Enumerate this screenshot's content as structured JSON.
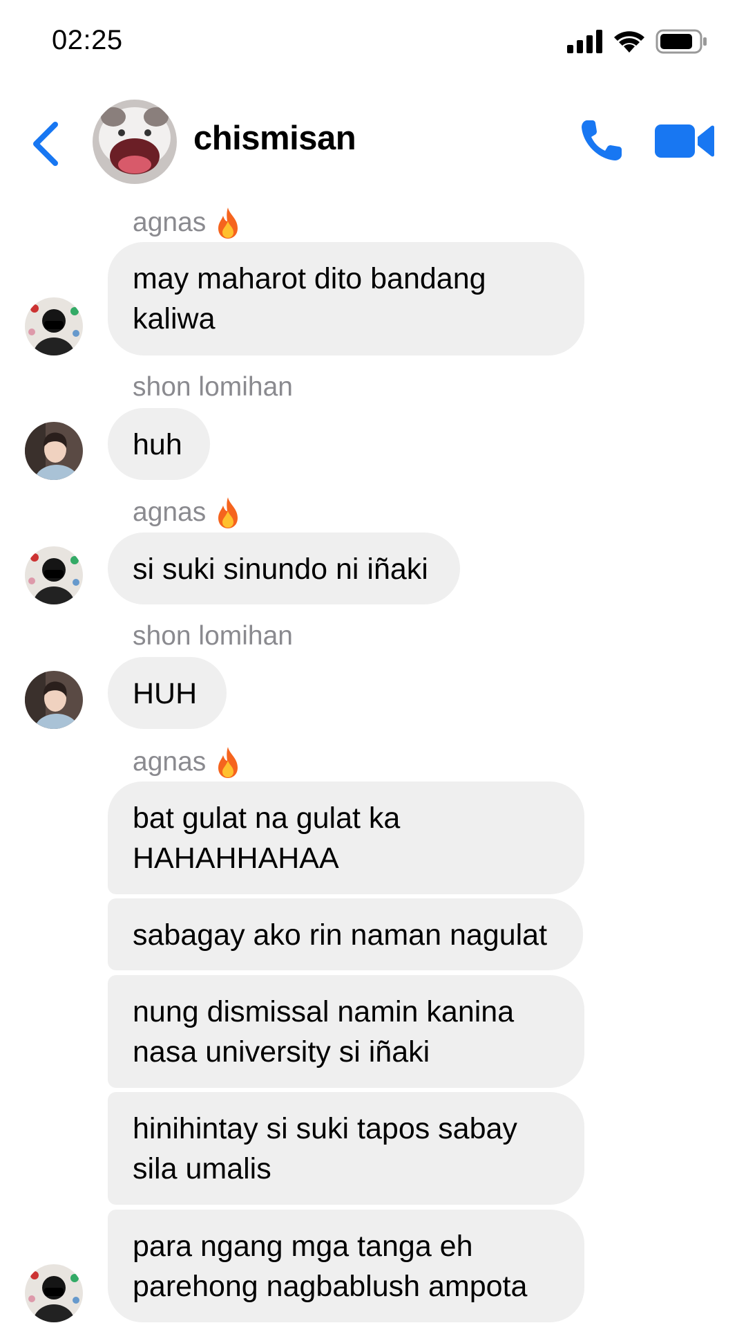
{
  "status": {
    "time": "02:25"
  },
  "header": {
    "title": "chismisan"
  },
  "messages": [
    {
      "sender": "agnas",
      "emoji": "fire",
      "text": "may maharot dito bandang kaliwa"
    },
    {
      "sender": "shon lomihan",
      "text": "huh"
    },
    {
      "sender": "agnas",
      "emoji": "fire",
      "text": "si suki sinundo ni iñaki"
    },
    {
      "sender": "shon lomihan",
      "text": "HUH"
    },
    {
      "sender": "agnas",
      "emoji": "fire"
    },
    {
      "text": "bat gulat na gulat ka HAHAHHAHAA"
    },
    {
      "text": "sabagay ako rin naman nagulat"
    },
    {
      "text": "nung dismissal namin kanina nasa university si iñaki"
    },
    {
      "text": "hinihintay si suki tapos sabay sila umalis"
    },
    {
      "text": "para ngang mga tanga eh parehong nagbablush ampota"
    }
  ],
  "colors": {
    "accent": "#1877f2",
    "bubble": "#efefef",
    "sender_label": "#8a8a8f"
  }
}
